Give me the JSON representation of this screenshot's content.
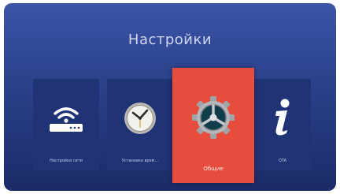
{
  "header": {
    "title": "Настройки"
  },
  "tiles": [
    {
      "id": "network",
      "label": "Настройки сети",
      "icon": "wifi-router-icon"
    },
    {
      "id": "clock",
      "label": "Установка врем...",
      "icon": "clock-icon"
    },
    {
      "id": "general",
      "label": "Общие",
      "icon": "gear-icon",
      "selected": true
    },
    {
      "id": "info",
      "label": "OTA",
      "icon": "info-icon"
    }
  ],
  "colors": {
    "background_top": "#3a55a8",
    "background_bottom": "#1b2b68",
    "tile": "#1f3375",
    "selected_tile": "#e74c3c"
  }
}
